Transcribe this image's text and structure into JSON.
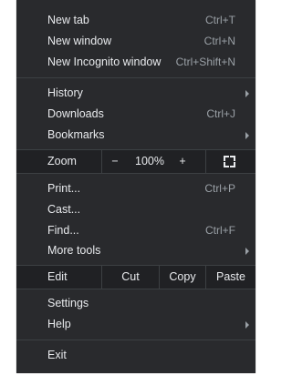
{
  "menu": {
    "group1": [
      {
        "label": "New tab",
        "shortcut": "Ctrl+T"
      },
      {
        "label": "New window",
        "shortcut": "Ctrl+N"
      },
      {
        "label": "New Incognito window",
        "shortcut": "Ctrl+Shift+N"
      }
    ],
    "group2": [
      {
        "label": "History",
        "shortcut": ""
      },
      {
        "label": "Downloads",
        "shortcut": "Ctrl+J"
      },
      {
        "label": "Bookmarks",
        "shortcut": ""
      }
    ],
    "zoom": {
      "label": "Zoom",
      "minus": "−",
      "value": "100%",
      "plus": "+"
    },
    "group3": [
      {
        "label": "Print...",
        "shortcut": "Ctrl+P"
      },
      {
        "label": "Cast...",
        "shortcut": ""
      },
      {
        "label": "Find...",
        "shortcut": "Ctrl+F"
      },
      {
        "label": "More tools",
        "shortcut": ""
      }
    ],
    "edit": {
      "label": "Edit",
      "cut": "Cut",
      "copy": "Copy",
      "paste": "Paste"
    },
    "group4": [
      {
        "label": "Settings",
        "shortcut": ""
      },
      {
        "label": "Help",
        "shortcut": ""
      }
    ],
    "exit": {
      "label": "Exit"
    }
  },
  "colors": {
    "menu_bg": "#292a2d",
    "strip_bg": "#202124",
    "text": "#e8eaed",
    "shortcut_text": "#9aa0a6",
    "separator": "#3c4043"
  },
  "icons": {
    "submenu": "chevron-right-icon",
    "fullscreen": "fullscreen-icon"
  }
}
